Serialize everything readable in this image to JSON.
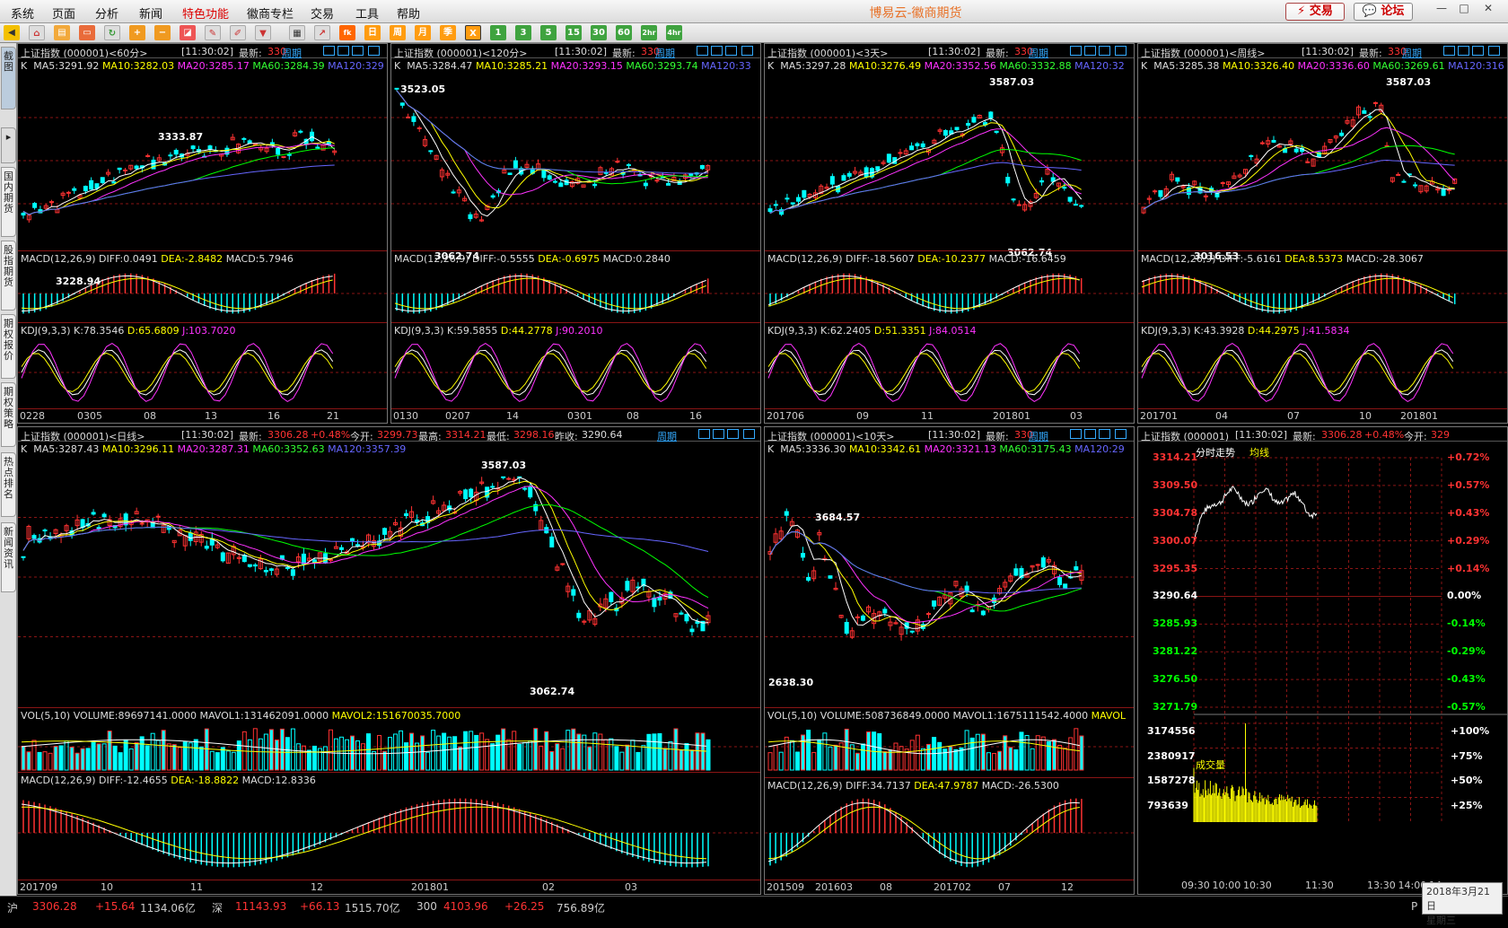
{
  "menu": [
    "系统",
    "页面",
    "分析",
    "新闻",
    "特色功能",
    "徽商专栏",
    "交易",
    "工具",
    "帮助"
  ],
  "app_title": "博易云-徽商期货",
  "top_buttons": {
    "trade": "交易",
    "forum": "论坛"
  },
  "toolbar": {
    "fk": "fk",
    "day": "日",
    "week": "周",
    "month": "月",
    "season": "季",
    "x": "X",
    "m1": "1",
    "m3": "3",
    "m5": "5",
    "m15": "15",
    "m30": "30",
    "m60": "60",
    "h2": "2hr",
    "h4": "4hr"
  },
  "left_tabs": [
    "截图",
    "国内期货",
    "股指期货",
    "期权报价",
    "期权策略",
    "热点排名",
    "新闻资讯"
  ],
  "panels": {
    "p60m": {
      "title": "上证指数 (000001)<60分>",
      "time": "[11:30:02]",
      "latest_label": "最新:",
      "latest": "330",
      "period": "周期",
      "ma": [
        "K",
        "MA5:3291.92",
        "MA10:3282.03",
        "MA20:3285.17",
        "MA60:3284.39",
        "MA120:329"
      ],
      "macd": [
        "MACD(12,26,9)",
        "DIFF:0.0491",
        "DEA:-2.8482",
        "MACD:5.7946"
      ],
      "kdj": [
        "KDJ(9,3,3)",
        "K:78.3546",
        "D:65.6809",
        "J:103.7020"
      ],
      "xlabels": [
        "0228",
        "0305",
        "08",
        "13",
        "16",
        "21"
      ],
      "high": "3333.87",
      "low": "3228.94"
    },
    "p120m": {
      "title": "上证指数 (000001)<120分>",
      "time": "[11:30:02]",
      "latest_label": "最新:",
      "latest": "330",
      "period": "周期",
      "ma": [
        "K",
        "MA5:3284.47",
        "MA10:3285.21",
        "MA20:3293.15",
        "MA60:3293.74",
        "MA120:33"
      ],
      "macd": [
        "MACD(12,26,9)",
        "DIFF:-0.5555",
        "DEA:-0.6975",
        "MACD:0.2840"
      ],
      "kdj": [
        "KDJ(9,3,3)",
        "K:59.5855",
        "D:44.2778",
        "J:90.2010"
      ],
      "xlabels": [
        "0130",
        "0207",
        "14",
        "0301",
        "08",
        "16"
      ],
      "high": "3523.05",
      "low": "3062.74"
    },
    "p3d": {
      "title": "上证指数 (000001)<3天>",
      "time": "[11:30:02]",
      "latest_label": "最新:",
      "latest": "330",
      "period": "周期",
      "ma": [
        "K",
        "MA5:3297.28",
        "MA10:3276.49",
        "MA20:3352.56",
        "MA60:3332.88",
        "MA120:32"
      ],
      "macd": [
        "MACD(12,26,9)",
        "DIFF:-18.5607",
        "DEA:-10.2377",
        "MACD:-16.6459"
      ],
      "kdj": [
        "KDJ(9,3,3)",
        "K:62.2405",
        "D:51.3351",
        "J:84.0514"
      ],
      "xlabels": [
        "201706",
        "09",
        "11",
        "201801",
        "03"
      ],
      "high": "3587.03",
      "low": "3062.74"
    },
    "pweek": {
      "title": "上证指数 (000001)<周线>",
      "time": "[11:30:02]",
      "latest_label": "最新:",
      "latest": "330",
      "period": "周期",
      "ma": [
        "K",
        "MA5:3285.38",
        "MA10:3326.40",
        "MA20:3336.60",
        "MA60:3269.61",
        "MA120:316"
      ],
      "macd": [
        "MACD(12,26,9)",
        "DIFF:-5.6161",
        "DEA:8.5373",
        "MACD:-28.3067"
      ],
      "kdj": [
        "KDJ(9,3,3)",
        "K:43.3928",
        "D:44.2975",
        "J:41.5834"
      ],
      "xlabels": [
        "201701",
        "04",
        "07",
        "10",
        "201801"
      ],
      "high": "3587.03",
      "low": "3016.53"
    },
    "pday": {
      "title": "上证指数 (000001)<日线>",
      "time": "[11:30:02]",
      "latest_label": "最新:",
      "latest": "3306.28",
      "chg": "+0.48%",
      "open_label": "今开:",
      "open": "3299.73",
      "hi_label": "最高:",
      "hi": "3314.21",
      "lo_label": "最低:",
      "lo": "3298.16",
      "prev_label": "昨收:",
      "prev": "3290.64",
      "period": "周期",
      "ma": [
        "K",
        "MA5:3287.43",
        "MA10:3296.11",
        "MA20:3287.31",
        "MA60:3352.63",
        "MA120:3357.39"
      ],
      "vol": [
        "VOL(5,10)",
        "VOLUME:89697141.0000",
        "MAVOL1:131462091.0000",
        "MAVOL2:151670035.7000"
      ],
      "macd": [
        "MACD(12,26,9)",
        "DIFF:-12.4655",
        "DEA:-18.8822",
        "MACD:12.8336"
      ],
      "xlabels": [
        "201709",
        "10",
        "11",
        "12",
        "201801",
        "02",
        "03"
      ],
      "high": "3587.03",
      "low": "3062.74"
    },
    "p10d": {
      "title": "上证指数 (000001)<10天>",
      "time": "[11:30:02]",
      "latest_label": "最新:",
      "latest": "330",
      "period": "周期",
      "ma": [
        "K",
        "MA5:3336.30",
        "MA10:3342.61",
        "MA20:3321.13",
        "MA60:3175.43",
        "MA120:29"
      ],
      "vol": [
        "VOL(5,10)",
        "VOLUME:508736849.0000",
        "MAVOL1:1675111542.4000",
        "MAVOL"
      ],
      "macd": [
        "MACD(12,26,9)",
        "DIFF:34.7137",
        "DEA:47.9787",
        "MACD:-26.5300"
      ],
      "xlabels": [
        "201509",
        "201603",
        "08",
        "201702",
        "07",
        "12"
      ],
      "high": "3684.57",
      "low": "2638.30"
    },
    "ptick": {
      "title": "上证指数 (000001)",
      "time": "[11:30:02]",
      "latest_label": "最新:",
      "latest": "3306.28",
      "chg": "+0.48%",
      "open_label": "今开:",
      "open": "329",
      "tab1": "分时走势",
      "tab2": "均线",
      "vol_label": "成交量",
      "prices": [
        "3314.21",
        "3309.50",
        "3304.78",
        "3300.07",
        "3295.35",
        "3290.64",
        "3285.93",
        "3281.22",
        "3276.50",
        "3271.79"
      ],
      "pcts": [
        "+0.72%",
        "+0.57%",
        "+0.43%",
        "+0.29%",
        "+0.14%",
        "0.00%",
        "-0.14%",
        "-0.29%",
        "-0.43%",
        "-0.57%"
      ],
      "vols": [
        "3174556",
        "2380917",
        "1587278",
        "793639"
      ],
      "vpcts": [
        "+100%",
        "+75%",
        "+50%",
        "+25%"
      ],
      "times": [
        "09:30",
        "10:00",
        "10:30",
        "11:30",
        "13:30",
        "14:00",
        "14:"
      ]
    }
  },
  "statusbar": {
    "sh_label": "沪",
    "sh": "3306.28",
    "sh_chg": "+15.64",
    "sh_amt": "1134.06亿",
    "sz_label": "深",
    "sz": "11143.93",
    "sz_chg": "+66.13",
    "sz_amt": "1515.70亿",
    "c300_label": "300",
    "c300": "4103.96",
    "c300_chg": "+26.25",
    "c300_amt": "756.89亿"
  },
  "date": "2018年3月21日",
  "weekday": "星期三",
  "corner": "P",
  "colors": {
    "up": "#ff3232",
    "down": "#00ffff",
    "ma5": "#ffffff",
    "ma10": "#ffff00",
    "ma20": "#ff33ff",
    "ma60": "#00ff00",
    "ma120": "#6666ff",
    "grid": "#8a1515"
  }
}
